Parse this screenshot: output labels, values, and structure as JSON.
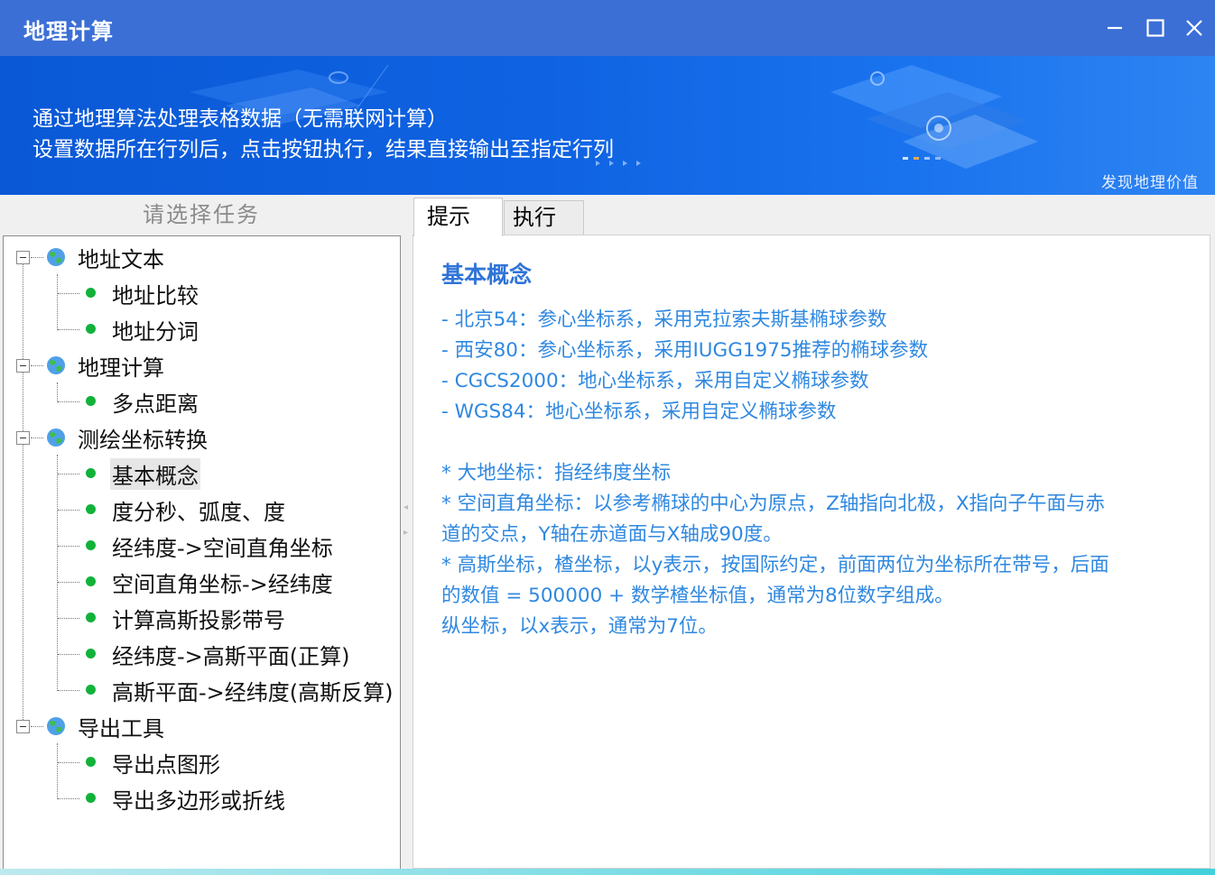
{
  "window": {
    "title": "地理计算",
    "accent": "#3b6fd6"
  },
  "banner": {
    "line1": "通过地理算法处理表格数据（无需联网计算）",
    "line2": "设置数据所在行列后，点击按钮执行，结果直接输出至指定行列",
    "slogan": "发现地理价值"
  },
  "left_panel": {
    "header": "请选择任务",
    "groups": [
      {
        "label": "地址文本",
        "icon": "globe-icon",
        "items": [
          "地址比较",
          "地址分词"
        ]
      },
      {
        "label": "地理计算",
        "icon": "globe-icon",
        "items": [
          "多点距离"
        ]
      },
      {
        "label": "测绘坐标转换",
        "icon": "globe-icon",
        "items": [
          "基本概念",
          "度分秒、弧度、度",
          "经纬度->空间直角坐标",
          "空间直角坐标->经纬度",
          "计算高斯投影带号",
          "经纬度->高斯平面(正算)",
          "高斯平面->经纬度(高斯反算)"
        ]
      },
      {
        "label": "导出工具",
        "icon": "globe-icon",
        "items": [
          "导出点图形",
          "导出多边形或折线"
        ]
      }
    ],
    "selected": "基本概念"
  },
  "tabs": [
    {
      "label": "提示",
      "active": true
    },
    {
      "label": "执行",
      "active": false
    }
  ],
  "content": {
    "heading": "基本概念",
    "lines": [
      "- 北京54：参心坐标系，采用克拉索夫斯基椭球参数",
      "- 西安80：参心坐标系，采用IUGG1975推荐的椭球参数",
      "- CGCS2000：地心坐标系，采用自定义椭球参数",
      "- WGS84：地心坐标系，采用自定义椭球参数",
      "* 大地坐标：指经纬度坐标",
      "* 空间直角坐标：以参考椭球的中心为原点，Z轴指向北极，X指向子午面与赤",
      "道的交点，Y轴在赤道面与X轴成90度。",
      "* 高斯坐标，楂坐标，以y表示，按国际约定，前面两位为坐标所在带号，后面",
      "的数值 = 500000 + 数学楂坐标值，通常为8位数字组成。",
      " 纵坐标，以x表示，通常为7位。"
    ],
    "text_color": "#2f88e0",
    "heading_color": "#2f74d8"
  }
}
